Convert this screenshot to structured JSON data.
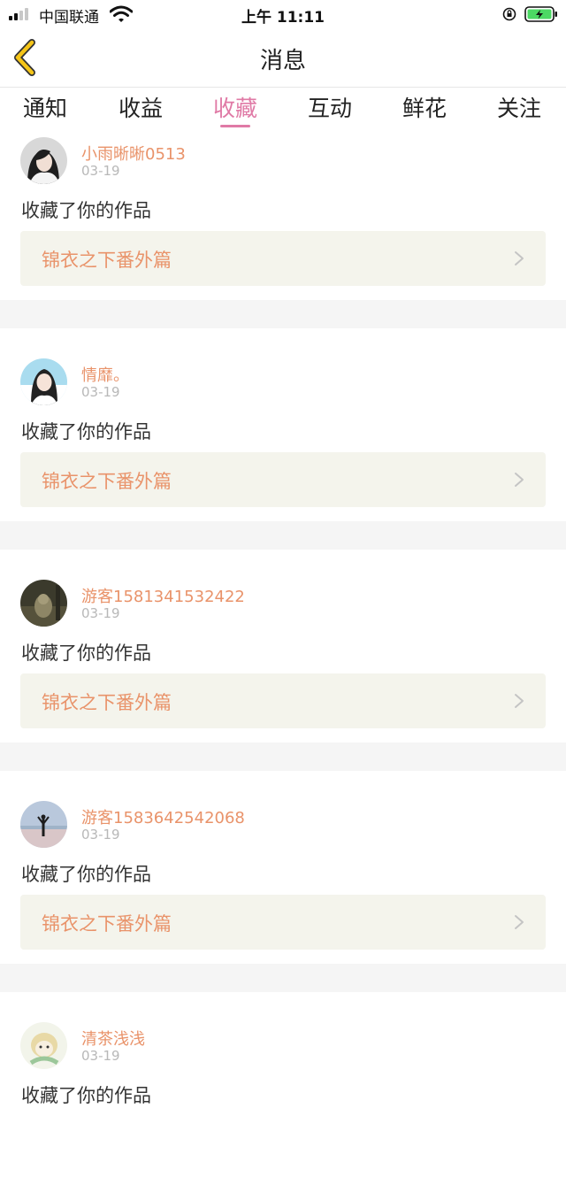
{
  "status_bar": {
    "carrier": "中国联通",
    "time": "上午 11:11"
  },
  "nav": {
    "title": "消息"
  },
  "tabs": [
    {
      "label": "通知",
      "active": false
    },
    {
      "label": "收益",
      "active": false
    },
    {
      "label": "收藏",
      "active": true
    },
    {
      "label": "互动",
      "active": false
    },
    {
      "label": "鲜花",
      "active": false
    },
    {
      "label": "关注",
      "active": false
    }
  ],
  "messages": [
    {
      "name": "小雨晰晰0513",
      "date": "03-19",
      "text": "收藏了你的作品",
      "work": "锦衣之下番外篇"
    },
    {
      "name": "情靡。",
      "date": "03-19",
      "text": "收藏了你的作品",
      "work": "锦衣之下番外篇"
    },
    {
      "name": "游客1581341532422",
      "date": "03-19",
      "text": "收藏了你的作品",
      "work": "锦衣之下番外篇"
    },
    {
      "name": "游客1583642542068",
      "date": "03-19",
      "text": "收藏了你的作品",
      "work": "锦衣之下番外篇"
    },
    {
      "name": "清茶浅浅",
      "date": "03-19",
      "text": "收藏了你的作品",
      "work": ""
    }
  ],
  "colors": {
    "accent": "#e07aa6",
    "name": "#e9936a",
    "card_bg": "#f4f4ec",
    "back_arrow": "#f5c518"
  }
}
